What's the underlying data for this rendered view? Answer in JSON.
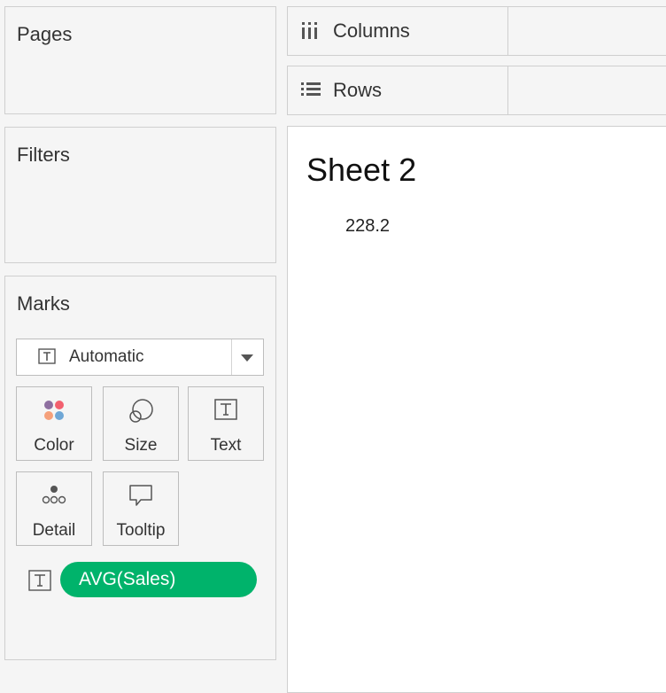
{
  "pages": {
    "title": "Pages"
  },
  "filters": {
    "title": "Filters"
  },
  "shelves": {
    "columns": {
      "label": "Columns",
      "icon": "columns-icon"
    },
    "rows": {
      "label": "Rows",
      "icon": "rows-icon"
    }
  },
  "sheet": {
    "title": "Sheet 2",
    "value": "228.2"
  },
  "marks": {
    "title": "Marks",
    "mark_type": {
      "selected": "Automatic",
      "icon": "text-mark-icon"
    },
    "cards": [
      {
        "label": "Color",
        "icon": "color-dots-icon"
      },
      {
        "label": "Size",
        "icon": "size-circles-icon"
      },
      {
        "label": "Text",
        "icon": "text-icon"
      },
      {
        "label": "Detail",
        "icon": "detail-dots-icon"
      },
      {
        "label": "Tooltip",
        "icon": "tooltip-icon"
      }
    ],
    "fields": [
      {
        "label": "AVG(Sales)",
        "icon": "text-icon",
        "color": "#00b36b"
      }
    ]
  },
  "colors": {
    "accent_pill": "#00b36b",
    "color_dots": [
      "#8e6fa0",
      "#f2606f",
      "#f5a07a",
      "#6fa7d6"
    ]
  }
}
